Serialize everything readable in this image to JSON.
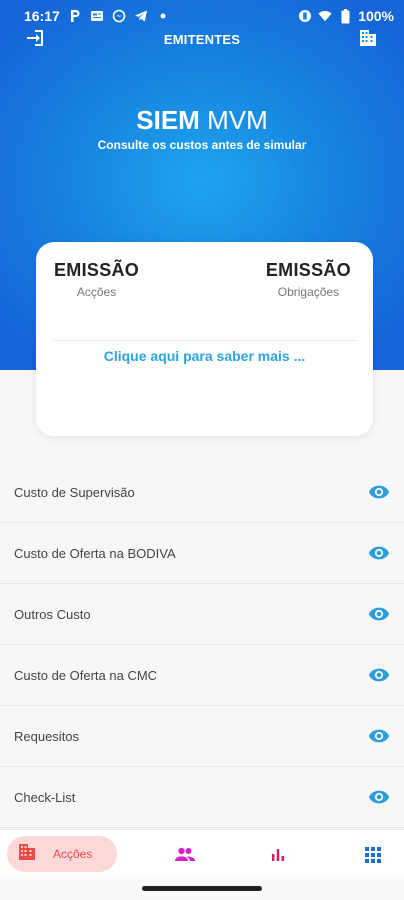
{
  "status_bar": {
    "time": "16:17",
    "battery": "100%",
    "notification_icons": [
      "p-app-icon",
      "news-icon",
      "messenger-icon",
      "telegram-icon",
      "dot-icon"
    ],
    "system_icons": [
      "vibrate-icon",
      "wifi-icon",
      "battery-icon"
    ]
  },
  "appbar": {
    "title": "EMITENTES",
    "left_icon": "login-icon",
    "right_icon": "building-icon"
  },
  "brand": {
    "title_bold": "SIEM",
    "title_light": "MVM",
    "subtitle": "Consulte os custos antes de simular"
  },
  "card": {
    "left_title": "EMISSÃO",
    "left_sub": "Acções",
    "right_title": "EMISSÃO",
    "right_sub": "Obrigações",
    "link": "Clique aqui para saber mais ..."
  },
  "list": {
    "items": [
      {
        "label": "Custo de Supervisão",
        "icon": "eye-icon"
      },
      {
        "label": "Custo de Oferta na BODIVA",
        "icon": "eye-icon"
      },
      {
        "label": "Outros Custo",
        "icon": "eye-icon"
      },
      {
        "label": "Custo de Oferta na CMC",
        "icon": "eye-icon"
      },
      {
        "label": "Requesitos",
        "icon": "eye-icon"
      },
      {
        "label": "Check-List",
        "icon": "eye-icon"
      }
    ]
  },
  "bottom_nav": {
    "active_label": "Acções",
    "items": [
      "building-icon",
      "people-icon",
      "bar-chart-icon",
      "grid-icon"
    ]
  },
  "colors": {
    "hero_start": "#1fa4ee",
    "hero_end": "#1565d8",
    "accent_link": "#2ea3de",
    "eye": "#2a9fd8",
    "nav_active_bg": "#fdd8d8",
    "nav_active_text": "#f0494a",
    "nav_people": "#d81ec8",
    "nav_chart": "#d8195a",
    "nav_grid": "#1e6bd8"
  }
}
